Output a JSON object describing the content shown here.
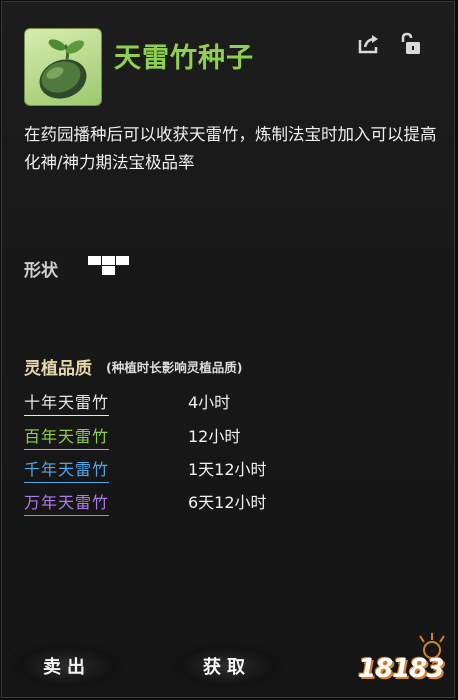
{
  "item": {
    "name": "天雷竹种子",
    "description": "在药园播种后可以收获天雷竹，炼制法宝时加入可以提高化神/神力期法宝极品率",
    "icon": "seed-icon"
  },
  "shape": {
    "label": "形状"
  },
  "quality": {
    "title": "灵植品质",
    "subtitle": "(种植时长影响灵植品质)",
    "tiers": [
      {
        "name": "十年天雷竹",
        "time": "4小时",
        "color": "#e8e8e8"
      },
      {
        "name": "百年天雷竹",
        "time": "12小时",
        "color": "#8fd04f"
      },
      {
        "name": "千年天雷竹",
        "time": "1天12小时",
        "color": "#4fa8e8"
      },
      {
        "name": "万年天雷竹",
        "time": "6天12小时",
        "color": "#b07ae8"
      }
    ]
  },
  "actions": {
    "sell": "卖出",
    "obtain": "获取"
  },
  "watermark": "18183",
  "colors": {
    "title": "#8fd04f",
    "quality_title": "#e6d8a6",
    "logo_accent": "#d9822b"
  }
}
